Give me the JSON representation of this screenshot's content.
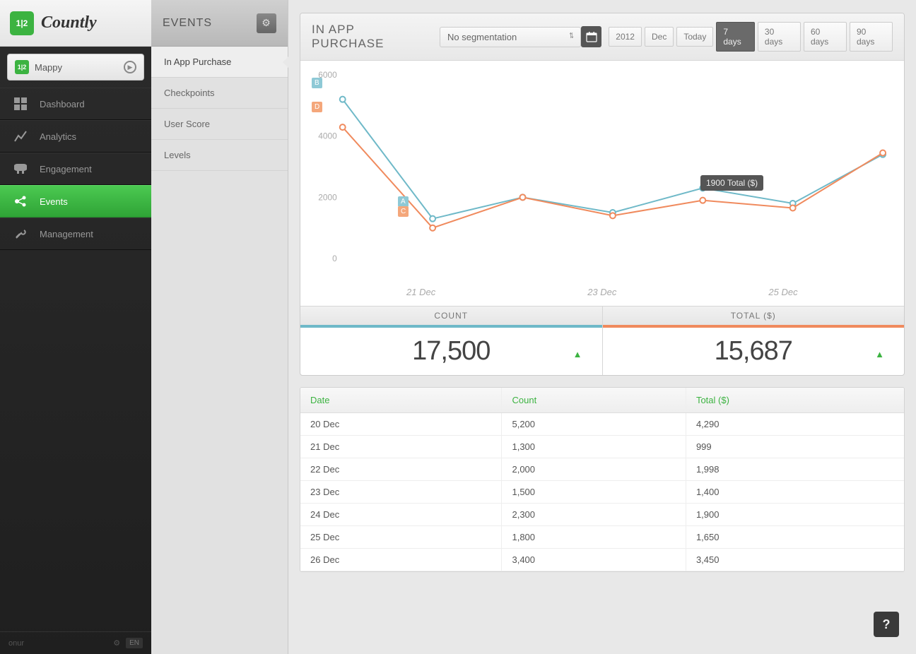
{
  "brand": "Countly",
  "current_app": "Mappy",
  "nav": [
    {
      "label": "Dashboard",
      "icon": "dashboard"
    },
    {
      "label": "Analytics",
      "icon": "analytics"
    },
    {
      "label": "Engagement",
      "icon": "engagement"
    },
    {
      "label": "Events",
      "icon": "events",
      "active": true
    },
    {
      "label": "Management",
      "icon": "management"
    }
  ],
  "footer": {
    "user": "onur",
    "lang": "EN"
  },
  "events_panel": {
    "title": "EVENTS",
    "items": [
      {
        "label": "In App Purchase",
        "active": true
      },
      {
        "label": "Checkpoints"
      },
      {
        "label": "User Score"
      },
      {
        "label": "Levels"
      }
    ]
  },
  "page": {
    "title": "IN APP PURCHASE",
    "segmentation": "No segmentation",
    "date_range": {
      "parts": [
        "2012",
        "Dec",
        "Today"
      ],
      "options": [
        "7 days",
        "30 days",
        "60 days",
        "90 days"
      ],
      "active": "7 days"
    },
    "stats": {
      "count": {
        "label": "COUNT",
        "value": "17,500",
        "trend": "up"
      },
      "total": {
        "label": "TOTAL ($)",
        "value": "15,687",
        "trend": "up"
      }
    },
    "tooltip": "1900 Total ($)",
    "table": {
      "headers": [
        "Date",
        "Count",
        "Total ($)"
      ],
      "rows": [
        [
          "20 Dec",
          "5,200",
          "4,290"
        ],
        [
          "21 Dec",
          "1,300",
          "999"
        ],
        [
          "22 Dec",
          "2,000",
          "1,998"
        ],
        [
          "23 Dec",
          "1,500",
          "1,400"
        ],
        [
          "24 Dec",
          "2,300",
          "1,900"
        ],
        [
          "25 Dec",
          "1,800",
          "1,650"
        ],
        [
          "26 Dec",
          "3,400",
          "3,450"
        ]
      ]
    }
  },
  "chart_data": {
    "type": "line",
    "x": [
      "20 Dec",
      "21 Dec",
      "22 Dec",
      "23 Dec",
      "24 Dec",
      "25 Dec",
      "26 Dec"
    ],
    "series": [
      {
        "name": "Count",
        "color": "#6fb9c8",
        "values": [
          5200,
          1300,
          2000,
          1500,
          2300,
          1800,
          3400
        ]
      },
      {
        "name": "Total ($)",
        "color": "#f08a5d",
        "values": [
          4290,
          999,
          1998,
          1400,
          1900,
          1650,
          3450
        ]
      }
    ],
    "yticks": [
      0,
      2000,
      4000,
      6000
    ],
    "ylim": [
      0,
      6000
    ],
    "x_axis_labels_shown": [
      "21 Dec",
      "23 Dec",
      "25 Dec"
    ],
    "flags": [
      "A",
      "B",
      "C",
      "D"
    ],
    "tooltip": {
      "x": "24 Dec",
      "series": "Total ($)",
      "value": 1900
    }
  }
}
